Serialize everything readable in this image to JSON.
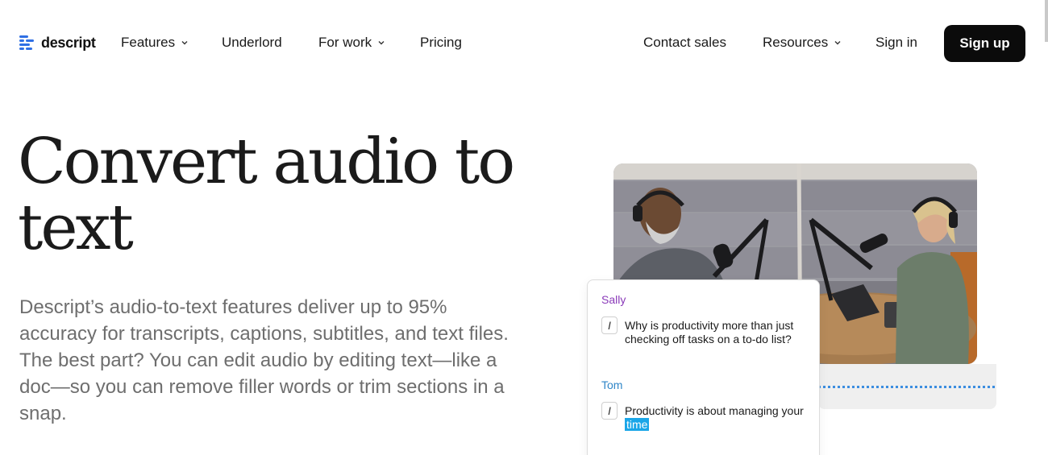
{
  "nav": {
    "logo_text": "descript",
    "features": "Features",
    "underlord": "Underlord",
    "for_work": "For work",
    "pricing": "Pricing",
    "contact_sales": "Contact sales",
    "resources": "Resources",
    "sign_in": "Sign in",
    "sign_up": "Sign up",
    "brand_color": "#2f6fe4"
  },
  "hero": {
    "title": "Convert audio to text",
    "description": "Descript’s audio-to-text features deliver up to 95% accuracy for transcripts, captions, subtitles, and text files. The best part? You can edit audio by editing text—like a doc—so you can remove filler words or trim sections in a snap."
  },
  "transcript": {
    "speaker1": "Sally",
    "line1": "Why is productivity more than just checking off tasks on a to-do list?",
    "speaker2": "Tom",
    "line2_prefix": "Productivity is about managing your",
    "line2_highlight": "time",
    "cursor_glyph": "I",
    "speaker1_color": "#8a3ab9",
    "speaker2_color": "#2f86c8",
    "highlight_color": "#1aa6e8"
  }
}
